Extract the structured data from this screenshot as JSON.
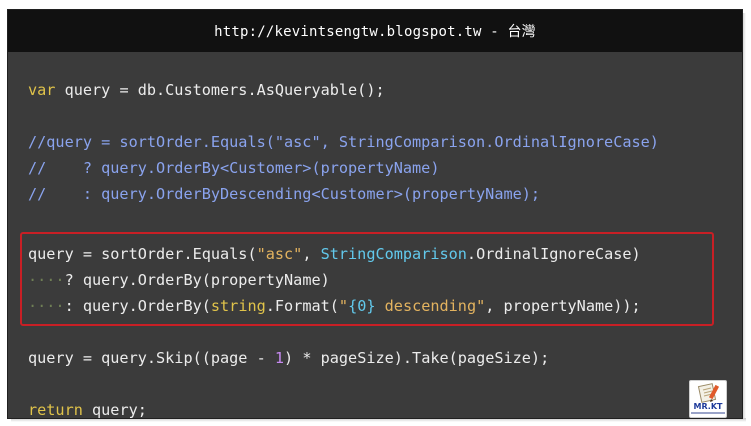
{
  "header": {
    "url_text": "http://kevintsengtw.blogspot.tw - 台灣"
  },
  "code": {
    "line1": {
      "kw": "var",
      "rest": " query = db.Customers.AsQueryable();"
    },
    "line2": {
      "text": "//query = sortOrder.Equals(\"asc\", StringComparison.OrdinalIgnoreCase)"
    },
    "line3": {
      "text": "//    ? query.OrderBy<Customer>(propertyName)"
    },
    "line4": {
      "text": "//    : query.OrderByDescending<Customer>(propertyName);"
    },
    "line5": {
      "a": "query = sortOrder.Equals(",
      "str": "\"asc\"",
      "b": ", ",
      "typ": "StringComparison",
      "c": ".OrdinalIgnoreCase)"
    },
    "line6": {
      "ws": "····",
      "rest": "? query.OrderBy(propertyName)"
    },
    "line7": {
      "ws": "····",
      "a": ": query.OrderBy(",
      "kw": "string",
      "b": ".Format(",
      "str1": "\"",
      "fmt": "{0}",
      "str2": " descending\"",
      "c": ", propertyName));"
    },
    "line8": {
      "a": "query = query.Skip((page - ",
      "num": "1",
      "b": ") * pageSize).Take(pageSize);"
    },
    "line9": {
      "kw": "return",
      "rest": " query;"
    }
  },
  "logo": {
    "text": "MR.KT"
  },
  "colors": {
    "background": "#3b3b3b",
    "header": "#111111",
    "keyword": "#e0c34a",
    "comment": "#8aa3ee",
    "string": "#e3b35f",
    "number": "#c68af0",
    "type": "#62c9ec",
    "highlight_border": "#c81f25"
  }
}
